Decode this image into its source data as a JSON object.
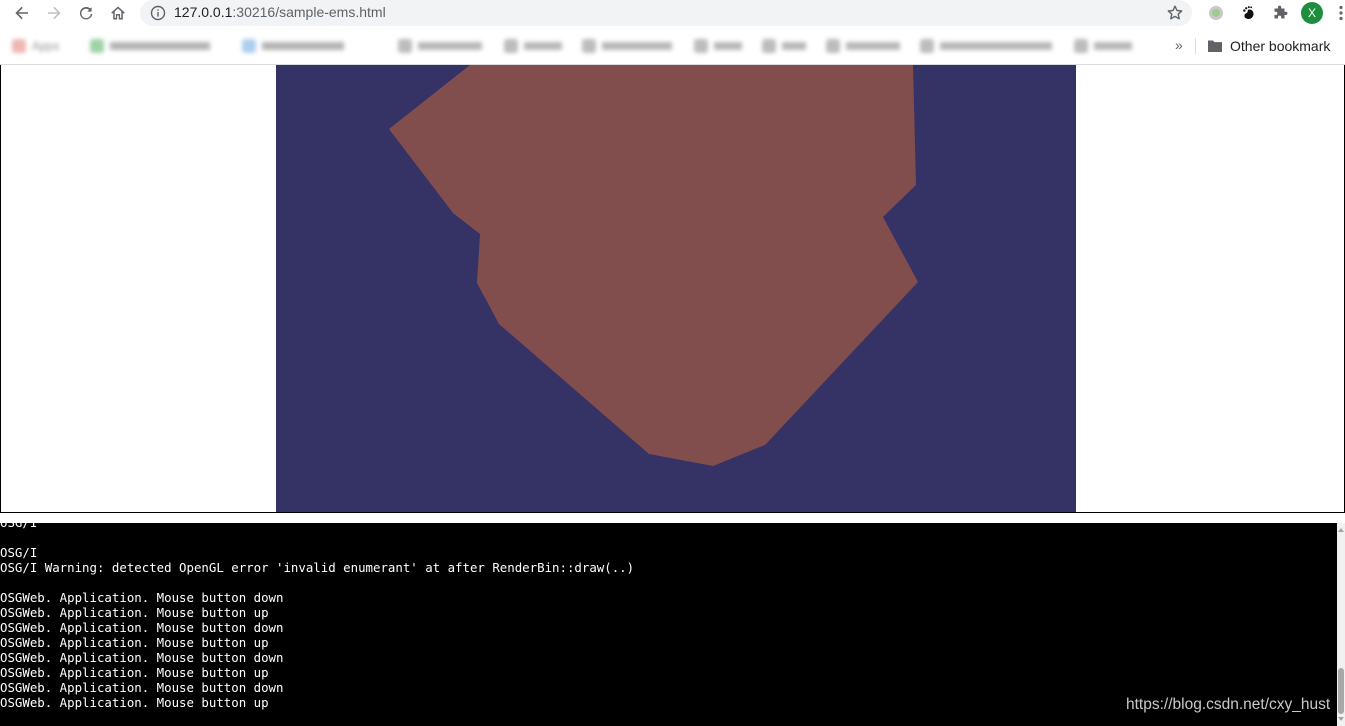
{
  "browser": {
    "url_host": "127.0.0.1",
    "url_path": ":30216/sample-ems.html",
    "avatar_initial": "X",
    "icons": {
      "back": "arrow-left-icon",
      "forward": "arrow-right-icon",
      "reload": "reload-icon",
      "home": "home-icon",
      "site_info": "info-icon",
      "bookmark_star": "star-icon",
      "extension_1": "circle-extension-icon",
      "extension_2": "gnome-foot-extension-icon",
      "extensions": "puzzle-piece-icon",
      "menu": "three-dots-icon"
    }
  },
  "bookmarks_bar": {
    "overflow_label": "»",
    "other_bookmarks_label": "Other bookmark",
    "blurred_items": [
      "Apps",
      "",
      "",
      "",
      "",
      "",
      "",
      "",
      "",
      "",
      "",
      ""
    ]
  },
  "canvas": {
    "background_color": "#353266",
    "shape_color": "#824e4d"
  },
  "console": {
    "lines": [
      "OSG/I",
      "",
      "OSG/I",
      "OSG/I Warning: detected OpenGL error 'invalid enumerant' at after RenderBin::draw(..)",
      "",
      "OSGWeb. Application. Mouse button down",
      "OSGWeb. Application. Mouse button up",
      "OSGWeb. Application. Mouse button down",
      "OSGWeb. Application. Mouse button up",
      "OSGWeb. Application. Mouse button down",
      "OSGWeb. Application. Mouse button up",
      "OSGWeb. Application. Mouse button down",
      "OSGWeb. Application. Mouse button up"
    ]
  },
  "watermark": "https://blog.csdn.net/cxy_hust"
}
